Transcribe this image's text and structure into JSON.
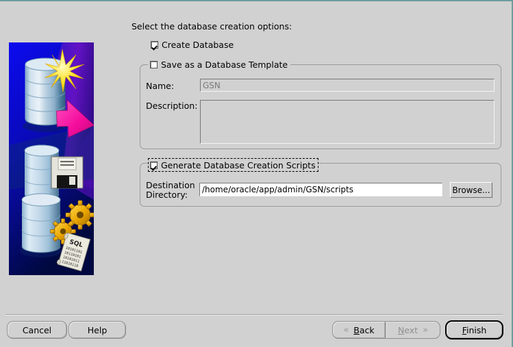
{
  "window": {
    "border_color": "#6d9c9e",
    "background": "#d1d1d1"
  },
  "heading": "Select the database creation options:",
  "options": {
    "create_database": {
      "label": "Create Database",
      "checked": true
    },
    "save_as_template": {
      "label": "Save as a Database Template",
      "checked": false,
      "name_label": "Name:",
      "name_value": "GSN",
      "description_label": "Description:",
      "description_value": ""
    },
    "generate_scripts": {
      "label": "Generate Database Creation Scripts",
      "checked": true,
      "focused": true,
      "destination_label": "Destination\nDirectory:",
      "destination_label_line1": "Destination",
      "destination_label_line2": "Directory:",
      "destination_value": "/home/oracle/app/admin/GSN/scripts",
      "browse_label": "Browse..."
    }
  },
  "footer": {
    "cancel": "Cancel",
    "help": "Help",
    "back": "Back",
    "back_mnemonic": "B",
    "back_rest": "ack",
    "back_icon": "chevron-double-left-icon",
    "back_glyph": "«",
    "next": "Next",
    "next_mnemonic": "N",
    "next_rest": "ext",
    "next_icon": "chevron-double-right-icon",
    "next_glyph": "»",
    "next_disabled": true,
    "finish_mnemonic": "F",
    "finish_rest": "inish",
    "finish_default": true
  },
  "artwork": {
    "name": "database-creation-illustration",
    "description": "Three blue database cylinders on a blue gradient background: top cylinder with a yellow starburst and magenta arrow, middle cylinder with a floppy disk, bottom cylinder with gold gears and a SQL scroll.",
    "colors": {
      "bg_top": "#0000ee",
      "bg_bottom": "#000a4a",
      "purple": "#5a00b4",
      "cylinder": "#c3d6e8",
      "star": "#ffe11a",
      "arrow": "#ff17a8",
      "gear": "#e0a800",
      "scroll": "#e8e8e0"
    },
    "scroll_text": "SQL"
  }
}
